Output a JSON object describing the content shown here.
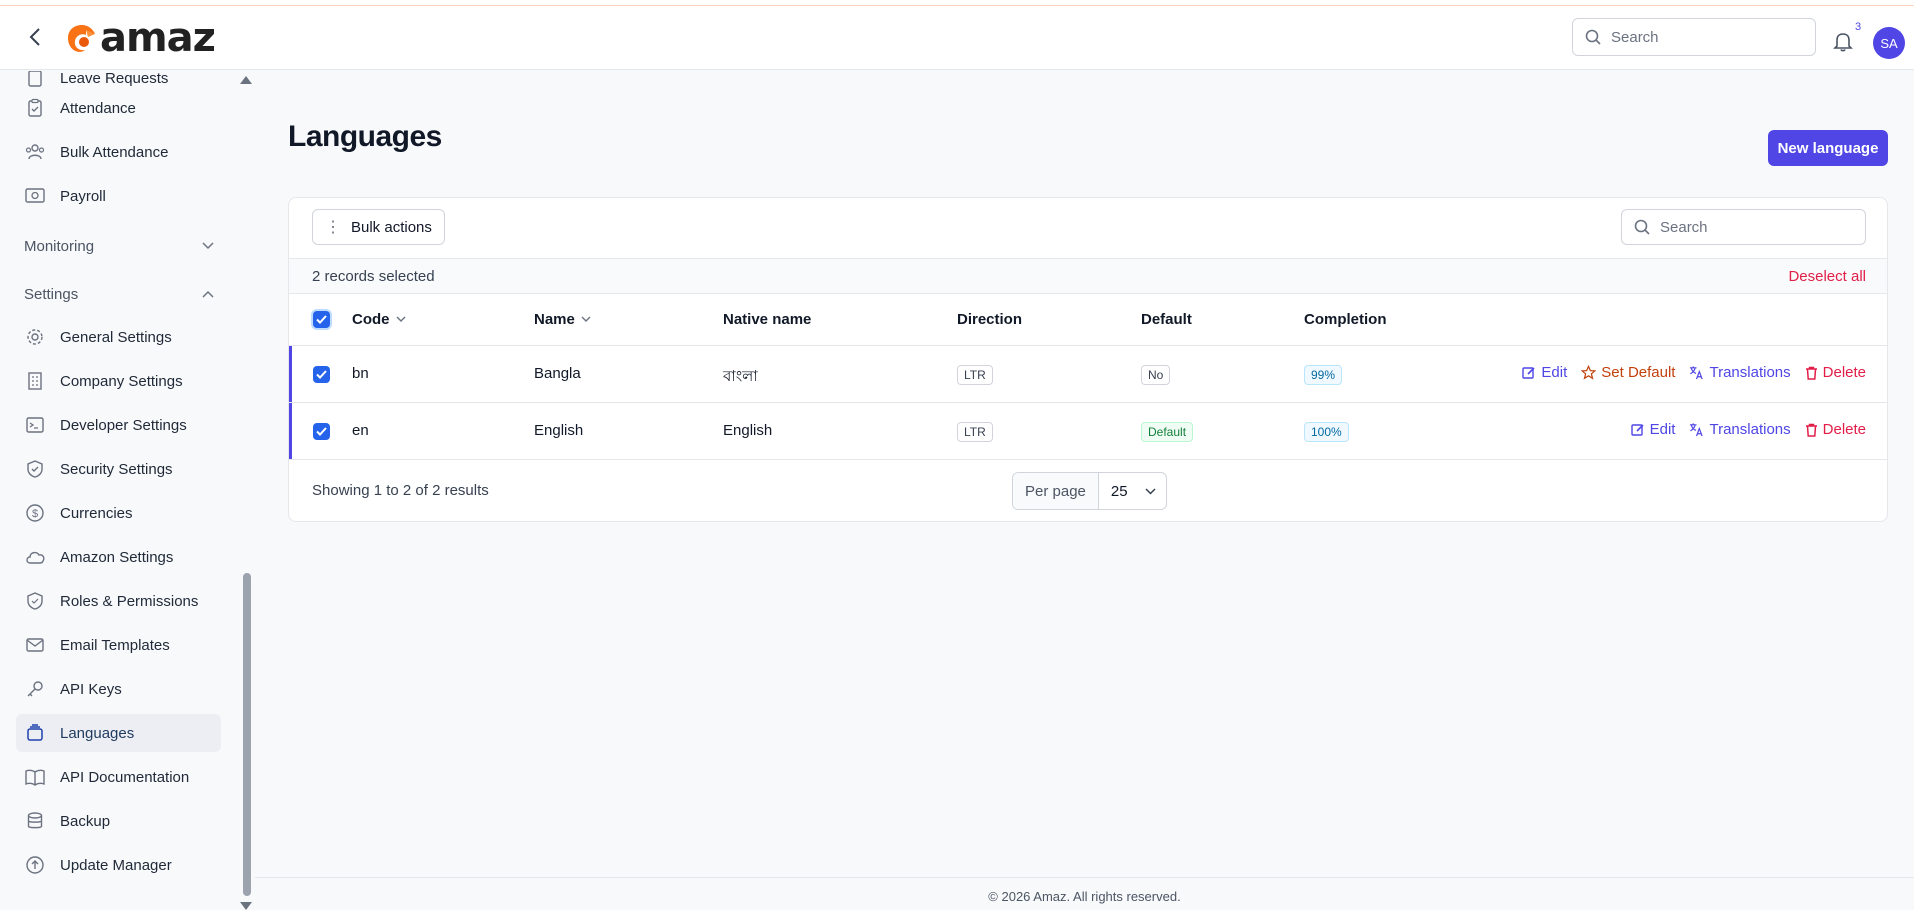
{
  "header": {
    "logo_text": "amaz",
    "search_placeholder": "Search",
    "notifications_count": "3",
    "avatar_initials": "SA"
  },
  "sidebar": {
    "partial_item": "Leave Requests",
    "items_top": [
      {
        "label": "Attendance",
        "icon": "clipboard-check-icon"
      },
      {
        "label": "Bulk Attendance",
        "icon": "users-icon"
      },
      {
        "label": "Payroll",
        "icon": "id-card-icon"
      }
    ],
    "group_monitoring": "Monitoring",
    "group_settings": "Settings",
    "settings_items": [
      {
        "label": "General Settings",
        "icon": "gear-icon"
      },
      {
        "label": "Company Settings",
        "icon": "building-icon"
      },
      {
        "label": "Developer Settings",
        "icon": "terminal-icon"
      },
      {
        "label": "Security Settings",
        "icon": "shield-check-icon"
      },
      {
        "label": "Currencies",
        "icon": "dollar-circle-icon"
      },
      {
        "label": "Amazon Settings",
        "icon": "cloud-icon"
      },
      {
        "label": "Roles & Permissions",
        "icon": "shield-icon"
      },
      {
        "label": "Email Templates",
        "icon": "envelope-icon"
      },
      {
        "label": "API Keys",
        "icon": "key-icon"
      },
      {
        "label": "Languages",
        "icon": "stack-icon",
        "active": true
      },
      {
        "label": "API Documentation",
        "icon": "book-icon"
      },
      {
        "label": "Backup",
        "icon": "database-icon"
      },
      {
        "label": "Update Manager",
        "icon": "arrow-up-circle-icon"
      }
    ]
  },
  "page": {
    "title": "Languages",
    "new_button": "New language"
  },
  "table": {
    "bulk_actions": "Bulk actions",
    "search_placeholder": "Search",
    "selected_text": "2 records selected",
    "deselect_all": "Deselect all",
    "columns": [
      "Code",
      "Name",
      "Native name",
      "Direction",
      "Default",
      "Completion"
    ],
    "rows": [
      {
        "code": "bn",
        "name": "Bangla",
        "native": "বাংলা",
        "direction": "LTR",
        "default": "No",
        "completion": "99%",
        "actions": [
          "Edit",
          "Set Default",
          "Translations",
          "Delete"
        ]
      },
      {
        "code": "en",
        "name": "English",
        "native": "English",
        "direction": "LTR",
        "default": "Default",
        "completion": "100%",
        "actions": [
          "Edit",
          "Translations",
          "Delete"
        ]
      }
    ],
    "showing": "Showing 1 to 2 of 2 results",
    "per_page_label": "Per page",
    "per_page_value": "25"
  },
  "footer": {
    "copyright": "© 2026 Amaz. All rights reserved."
  },
  "colors": {
    "primary": "#4f46e5",
    "danger": "#e11d48",
    "warning": "#c2410c",
    "success": "#15803d"
  }
}
